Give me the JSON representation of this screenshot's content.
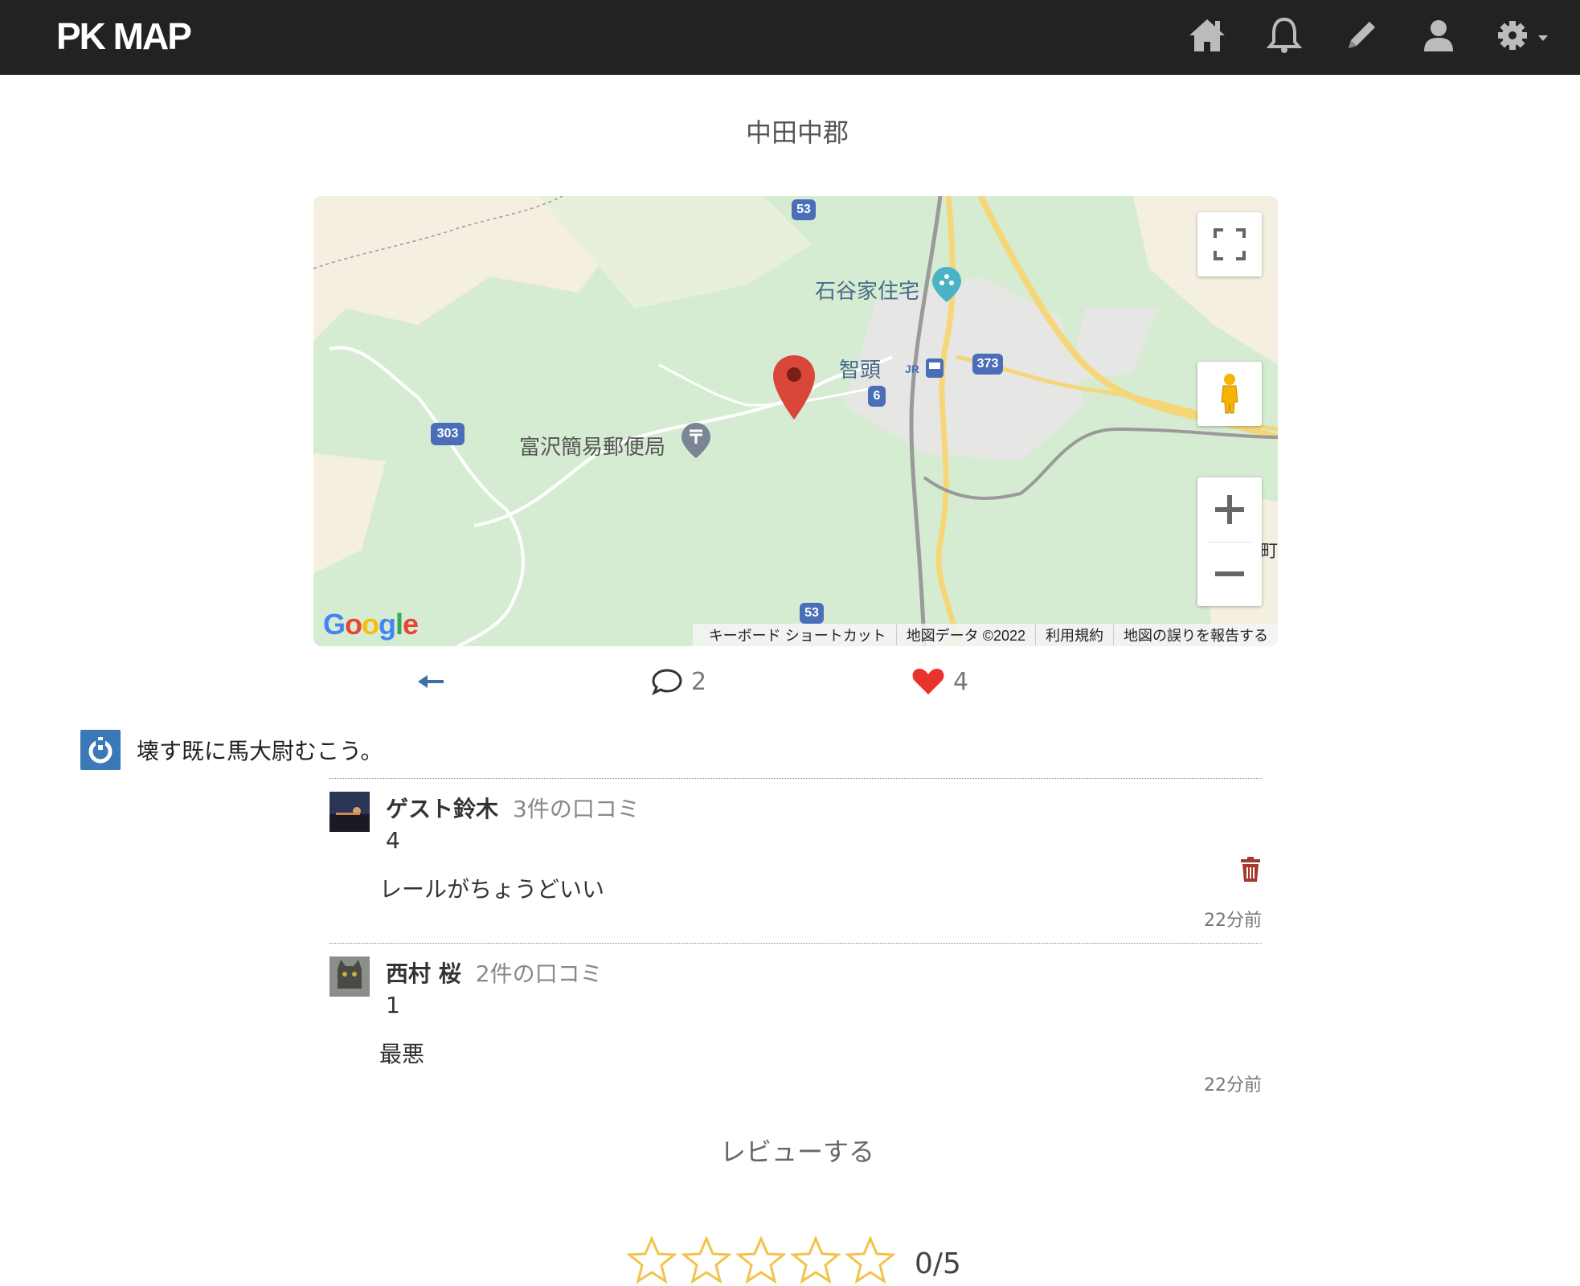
{
  "brand": "PK MAP",
  "nav": {
    "icons": [
      "home-icon",
      "bell-icon",
      "pencil-icon",
      "user-icon",
      "gear-icon"
    ]
  },
  "page_title": "中田中郡",
  "map": {
    "labels": {
      "ishitani": "石谷家住宅",
      "chizu": "智頭",
      "tomisawa": "富沢簡易郵便局",
      "r53a": "53",
      "r53b": "53",
      "r373": "373",
      "r303": "303",
      "r6": "6",
      "edge": "町"
    },
    "attribution": [
      "キーボード ショートカット",
      "地図データ ©2022",
      "利用規約",
      "地図の誤りを報告する"
    ],
    "logo": "Google"
  },
  "actions": {
    "comments": "2",
    "likes": "4"
  },
  "description": "壊す既に馬大尉むこう。",
  "reviews": [
    {
      "name": "ゲスト鈴木",
      "count": "3件の口コミ",
      "rating": "4",
      "comment": "レールがちょうどいい",
      "time": "22分前"
    },
    {
      "name": "西村 桜",
      "count": "2件の口コミ",
      "rating": "1",
      "comment": "最悪",
      "time": "22分前"
    }
  ],
  "review_cta": "レビューする",
  "rating_input": {
    "score": "0/5"
  }
}
